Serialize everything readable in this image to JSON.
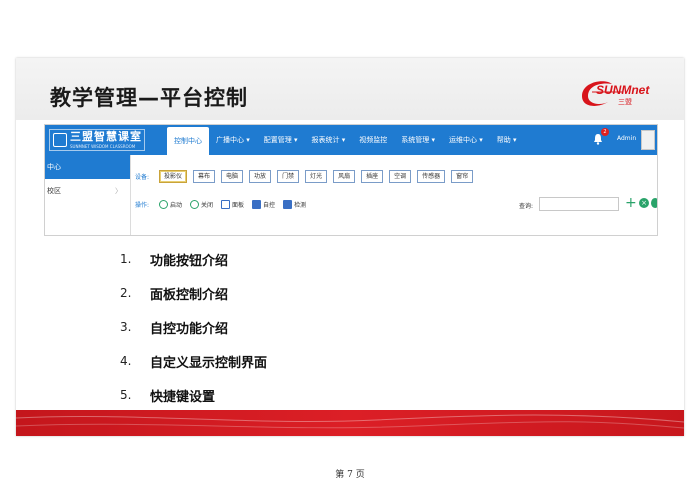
{
  "slide": {
    "title": "教学管理—平台控制",
    "brand": {
      "wordmark": "SUNMnet",
      "sub": "三盟"
    }
  },
  "app": {
    "logo": {
      "name": "三盟智慧课室",
      "tagline": "SUNMNET WISDOM CLASSROOM"
    },
    "nav": [
      {
        "label": "控制中心",
        "active": true
      },
      {
        "label": "广播中心 ▾"
      },
      {
        "label": "配置管理 ▾"
      },
      {
        "label": "报表统计 ▾"
      },
      {
        "label": "视频监控"
      },
      {
        "label": "系统管理 ▾"
      },
      {
        "label": "运维中心 ▾"
      },
      {
        "label": "帮助 ▾"
      }
    ],
    "notification_count": "2",
    "user": "Admin",
    "sidebar": [
      {
        "label": "中心",
        "active": true
      },
      {
        "label": "校区",
        "chev": "〉"
      }
    ],
    "devices_label": "设备:",
    "devices": [
      "投影仪",
      "幕布",
      "电脑",
      "功放",
      "门禁",
      "灯光",
      "风扇",
      "插座",
      "空调",
      "传感器",
      "窗帘"
    ],
    "ops_label": "操作:",
    "ops": [
      "启动",
      "关闭",
      "面板",
      "自控",
      "检测"
    ],
    "search_label": "查询:",
    "search_value": ""
  },
  "list": [
    {
      "num": "1.",
      "text": "功能按钮介绍"
    },
    {
      "num": "2.",
      "text": "面板控制介绍"
    },
    {
      "num": "3.",
      "text": "自控功能介绍"
    },
    {
      "num": "4.",
      "text": "自定义显示控制界面"
    },
    {
      "num": "5.",
      "text": "快捷键设置"
    }
  ],
  "page_number": "第 7 页",
  "colors": {
    "accent": "#1f7bd1",
    "brand_red": "#d8141b"
  }
}
